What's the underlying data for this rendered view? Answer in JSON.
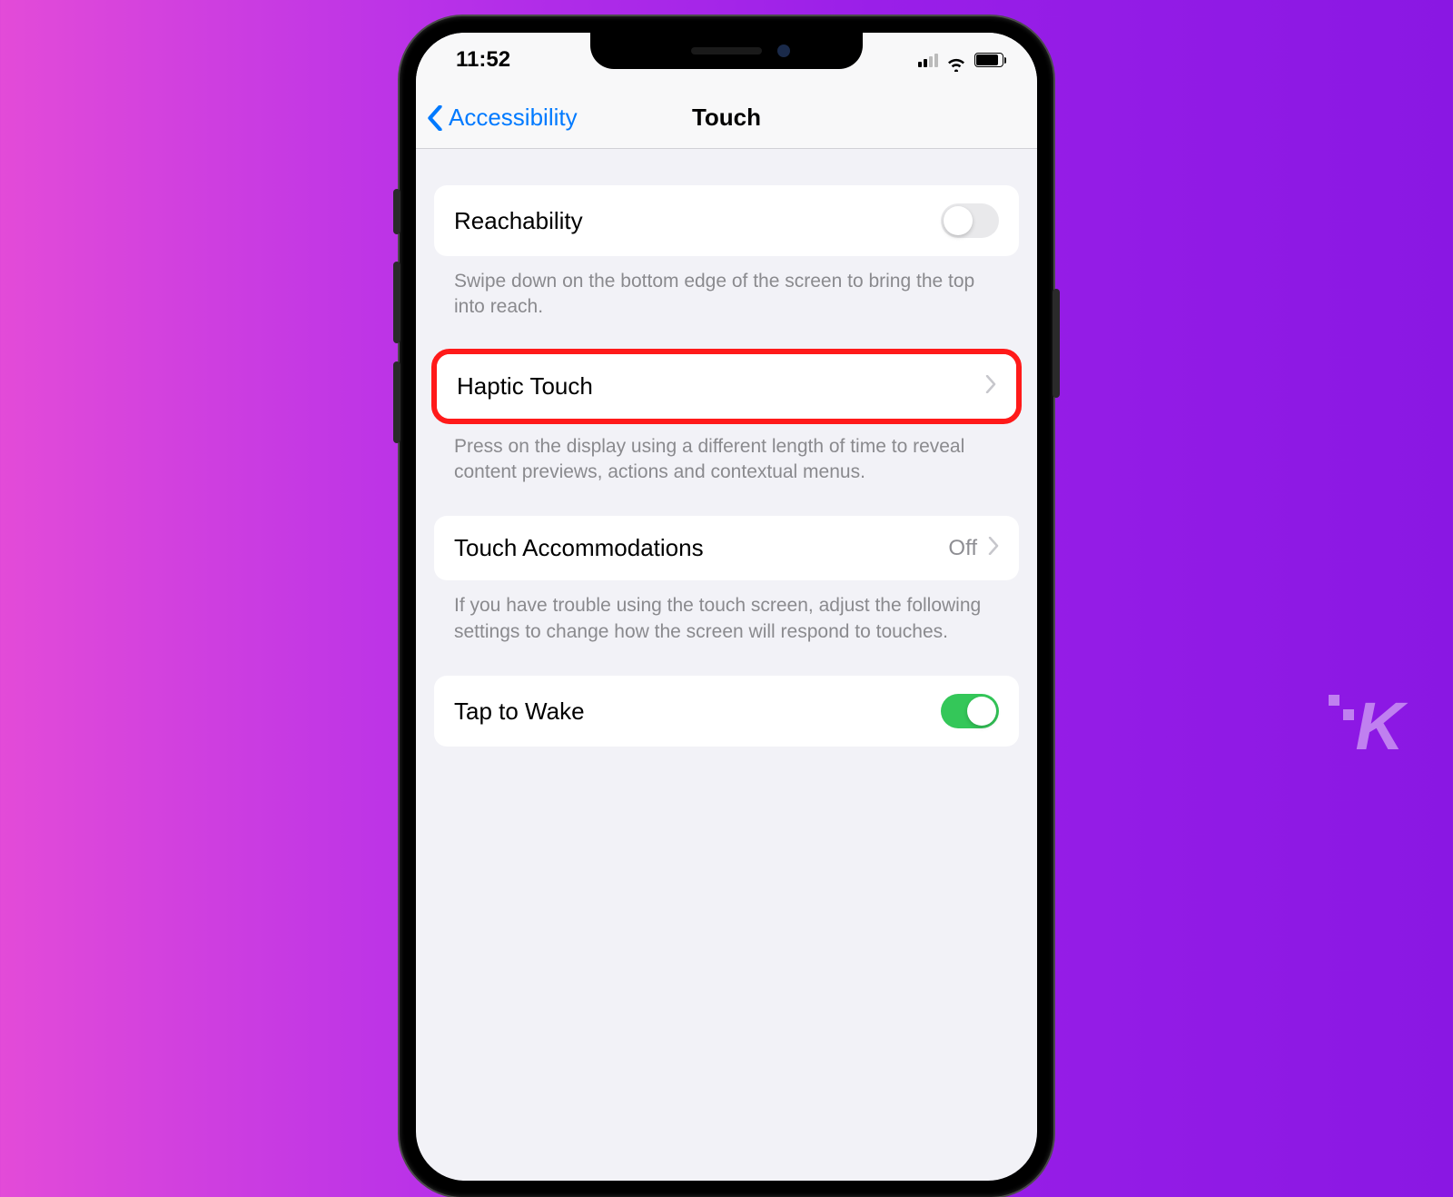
{
  "status": {
    "time": "11:52"
  },
  "nav": {
    "back_label": "Accessibility",
    "title": "Touch"
  },
  "settings": {
    "reachability": {
      "label": "Reachability",
      "footer": "Swipe down on the bottom edge of the screen to bring the top into reach.",
      "enabled": false
    },
    "haptic_touch": {
      "label": "Haptic Touch",
      "footer": "Press on the display using a different length of time to reveal content previews, actions and contextual menus."
    },
    "touch_accommodations": {
      "label": "Touch Accommodations",
      "value": "Off",
      "footer": "If you have trouble using the touch screen, adjust the following settings to change how the screen will respond to touches."
    },
    "tap_to_wake": {
      "label": "Tap to Wake",
      "enabled": true
    }
  },
  "watermark": "K"
}
